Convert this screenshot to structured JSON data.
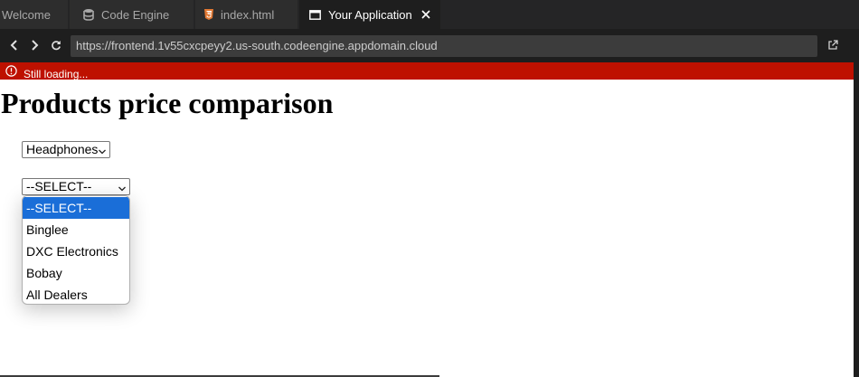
{
  "tabs": [
    {
      "label": "Welcome",
      "icon": "none"
    },
    {
      "label": "Code Engine",
      "icon": "database-icon"
    },
    {
      "label": "index.html",
      "icon": "html5-icon"
    },
    {
      "label": "Your Application",
      "icon": "browser-window-icon",
      "active": true
    }
  ],
  "address_bar": {
    "url": "https://frontend.1v55cxcpeyy2.us-south.codeengine.appdomain.cloud"
  },
  "alert": {
    "text": "Still loading...",
    "color": "#be1100"
  },
  "page": {
    "title": "Products price comparison",
    "product_select": {
      "value": "Headphones"
    },
    "dealer_select": {
      "value": "--SELECT--",
      "options": [
        "--SELECT--",
        "Binglee",
        "DXC Electronics",
        "Bobay",
        "All Dealers"
      ],
      "highlighted_option": "--SELECT--",
      "highlight_color": "#1a6ed8"
    }
  },
  "colors": {
    "tab_bar": "#252526",
    "active_tab": "#1e1e1e",
    "url_box": "#3c3c3c",
    "html_icon": "#e37933"
  }
}
